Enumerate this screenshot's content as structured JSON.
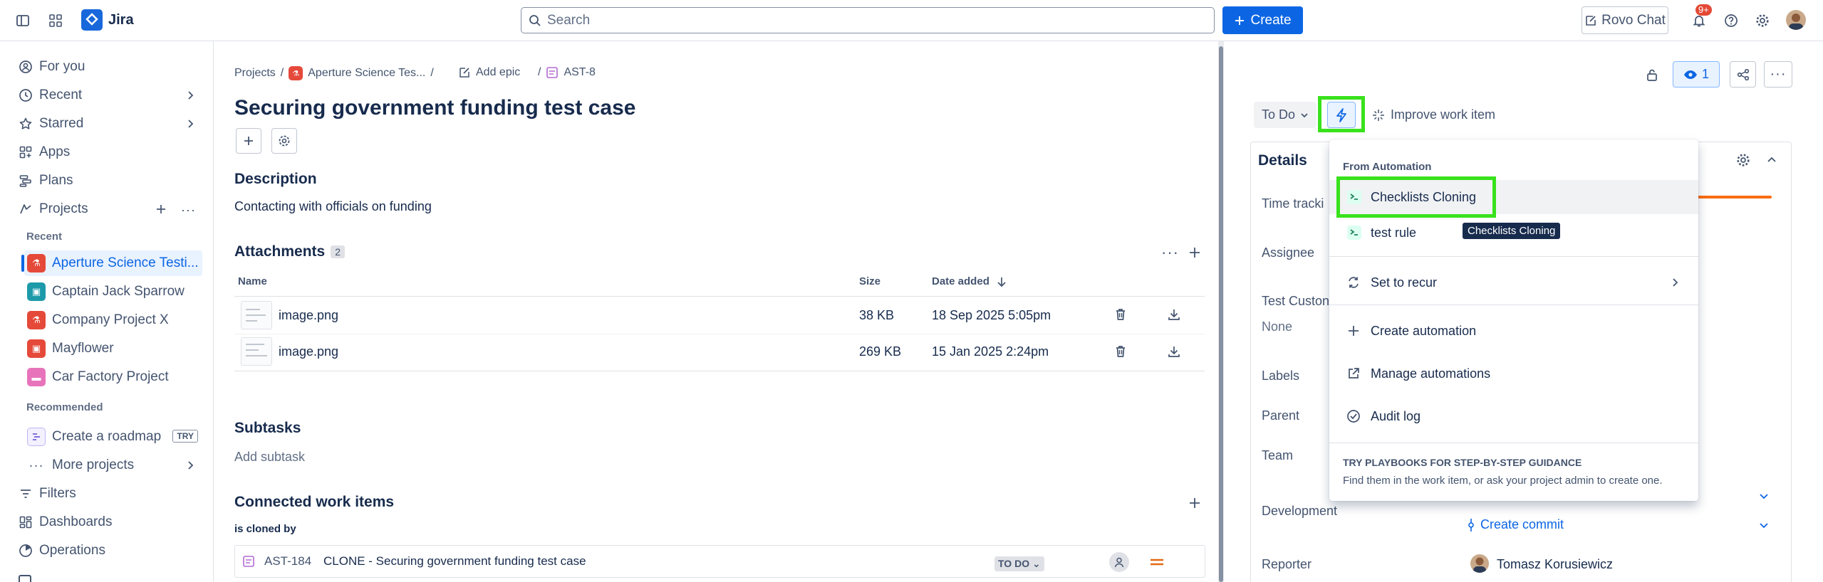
{
  "topbar": {
    "app_name": "Jira",
    "search_placeholder": "Search",
    "create_label": "Create",
    "rovo_label": "Rovo Chat",
    "notification_count": "9+"
  },
  "sidebar": {
    "items": [
      {
        "label": "For you",
        "icon": "person-icon"
      },
      {
        "label": "Recent",
        "icon": "clock-icon"
      },
      {
        "label": "Starred",
        "icon": "star-icon"
      },
      {
        "label": "Apps",
        "icon": "apps-icon"
      },
      {
        "label": "Plans",
        "icon": "plans-icon"
      },
      {
        "label": "Projects",
        "icon": "projects-icon"
      }
    ],
    "recent_heading": "Recent",
    "recent_projects": [
      {
        "label": "Aperture Science Testi...",
        "color": "#e5493a"
      },
      {
        "label": "Captain Jack Sparrow",
        "color": "#1d9aaa"
      },
      {
        "label": "Company Project X",
        "color": "#e5493a"
      },
      {
        "label": "Mayflower",
        "color": "#e5493a"
      },
      {
        "label": "Car Factory Project",
        "color": "#e774bb"
      }
    ],
    "recommended_heading": "Recommended",
    "recommended": [
      {
        "label": "Create a roadmap",
        "badge": "TRY"
      },
      {
        "label": "More projects"
      }
    ],
    "bottom_items": [
      {
        "label": "Filters"
      },
      {
        "label": "Dashboards"
      },
      {
        "label": "Operations"
      }
    ]
  },
  "breadcrumb": {
    "projects": "Projects",
    "project": "Aperture Science Tes...",
    "epic": "Add epic",
    "issue_key": "AST-8"
  },
  "issue": {
    "title": "Securing government funding test case",
    "description_heading": "Description",
    "description": "Contacting with officials on funding",
    "attachments_heading": "Attachments",
    "attachments_count": "2",
    "attachments_columns": {
      "name": "Name",
      "size": "Size",
      "date": "Date added"
    },
    "attachments": [
      {
        "name": "image.png",
        "size": "38 KB",
        "date": "18 Sep 2025 5:05pm"
      },
      {
        "name": "image.png",
        "size": "269 KB",
        "date": "15 Jan 2025 2:24pm"
      }
    ],
    "subtasks_heading": "Subtasks",
    "subtasks_add": "Add subtask",
    "connected_heading": "Connected work items",
    "connected_relation": "is cloned by",
    "connected_items": [
      {
        "key": "AST-184",
        "summary": "CLONE - Securing government funding test case",
        "status": "TO DO"
      }
    ]
  },
  "right_panel": {
    "watch_count": "1",
    "status": "To Do",
    "improve_label": "Improve work item",
    "details_heading": "Details",
    "fields": {
      "time_tracking": "Time tracki",
      "assignee": "Assignee",
      "test_custom": "Test Custon",
      "test_custom_value": "None",
      "labels": "Labels",
      "parent": "Parent",
      "team": "Team",
      "development": "Development",
      "create_commit": "Create commit",
      "reporter": "Reporter",
      "reporter_value": "Tomasz Korusiewicz"
    }
  },
  "automation_menu": {
    "section_heading": "From Automation",
    "rules": [
      {
        "label": "Checklists Cloning"
      },
      {
        "label": "test rule"
      }
    ],
    "set_to_recur": "Set to recur",
    "create_automation": "Create automation",
    "manage_automations": "Manage automations",
    "audit_log": "Audit log",
    "playbooks_heading": "TRY PLAYBOOKS FOR STEP-BY-STEP GUIDANCE",
    "playbooks_text": "Find them in the work item, or ask your project admin to create one.",
    "tooltip": "Checklists Cloning"
  },
  "colors": {
    "accent": "#0c66e4",
    "highlight": "#39e21c",
    "time_bar": "#fb6d14"
  }
}
